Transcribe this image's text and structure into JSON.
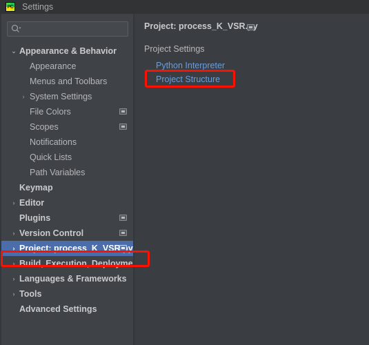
{
  "window": {
    "title": "Settings",
    "app_icon": "pycharm-icon",
    "icon_text": "PC"
  },
  "search": {
    "value": "",
    "placeholder": "",
    "icon": "search-icon"
  },
  "sidebar": {
    "items": [
      {
        "label": "Appearance & Behavior",
        "level": 0,
        "chevron": "⌄",
        "bold": true,
        "badge": false,
        "selected": false
      },
      {
        "label": "Appearance",
        "level": 1,
        "chevron": "",
        "bold": false,
        "badge": false,
        "selected": false
      },
      {
        "label": "Menus and Toolbars",
        "level": 1,
        "chevron": "",
        "bold": false,
        "badge": false,
        "selected": false
      },
      {
        "label": "System Settings",
        "level": 1,
        "chevron": "›",
        "bold": false,
        "badge": false,
        "selected": false
      },
      {
        "label": "File Colors",
        "level": 1,
        "chevron": "",
        "bold": false,
        "badge": true,
        "selected": false
      },
      {
        "label": "Scopes",
        "level": 1,
        "chevron": "",
        "bold": false,
        "badge": true,
        "selected": false
      },
      {
        "label": "Notifications",
        "level": 1,
        "chevron": "",
        "bold": false,
        "badge": false,
        "selected": false
      },
      {
        "label": "Quick Lists",
        "level": 1,
        "chevron": "",
        "bold": false,
        "badge": false,
        "selected": false
      },
      {
        "label": "Path Variables",
        "level": 1,
        "chevron": "",
        "bold": false,
        "badge": false,
        "selected": false
      },
      {
        "label": "Keymap",
        "level": 0,
        "chevron": "",
        "bold": true,
        "badge": false,
        "selected": false
      },
      {
        "label": "Editor",
        "level": 0,
        "chevron": "›",
        "bold": true,
        "badge": false,
        "selected": false
      },
      {
        "label": "Plugins",
        "level": 0,
        "chevron": "",
        "bold": true,
        "badge": true,
        "selected": false
      },
      {
        "label": "Version Control",
        "level": 0,
        "chevron": "›",
        "bold": true,
        "badge": true,
        "selected": false
      },
      {
        "label": "Project: process_K_VSR.py",
        "level": 0,
        "chevron": "›",
        "bold": true,
        "badge": true,
        "selected": true
      },
      {
        "label": "Build, Execution, Deployment",
        "level": 0,
        "chevron": "›",
        "bold": true,
        "badge": false,
        "selected": false
      },
      {
        "label": "Languages & Frameworks",
        "level": 0,
        "chevron": "›",
        "bold": true,
        "badge": false,
        "selected": false
      },
      {
        "label": "Tools",
        "level": 0,
        "chevron": "›",
        "bold": true,
        "badge": false,
        "selected": false
      },
      {
        "label": "Advanced Settings",
        "level": 0,
        "chevron": "",
        "bold": true,
        "badge": false,
        "selected": false
      }
    ]
  },
  "main": {
    "header": "Project: process_K_VSR.py",
    "header_badge": "settings-sync-icon",
    "section_label": "Project Settings",
    "links": [
      {
        "label": "Python Interpreter"
      },
      {
        "label": "Project Structure"
      }
    ]
  },
  "annotations": [
    {
      "name": "python-interpreter-highlight",
      "color": "#fb1202"
    },
    {
      "name": "project-node-highlight",
      "color": "#fb1202"
    }
  ],
  "colors": {
    "titlebar_bg": "#313335",
    "sidebar_bg": "#3f4246",
    "panel_bg": "#3a3d41",
    "selection_blue": "#4b6eab",
    "link_blue": "#6a9fe0",
    "annotation_red": "#fb1202",
    "text": "#b6b8ba"
  }
}
